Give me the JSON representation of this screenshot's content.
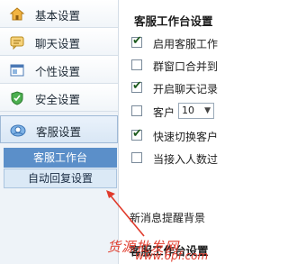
{
  "sidebar": {
    "items": [
      {
        "label": "基本设置",
        "icon": "house-icon"
      },
      {
        "label": "聊天设置",
        "icon": "chat-icon"
      },
      {
        "label": "个性设置",
        "icon": "window-icon"
      },
      {
        "label": "安全设置",
        "icon": "shield-icon"
      },
      {
        "label": "客服设置",
        "icon": "service-icon"
      }
    ],
    "sub_items": [
      {
        "label": "客服工作台",
        "state": "active"
      },
      {
        "label": "自动回复设置",
        "state": "normal"
      }
    ]
  },
  "main": {
    "section_title": "客服工作台设置",
    "options": [
      {
        "label": "启用客服工作",
        "checked": true
      },
      {
        "label": "群窗口合并到",
        "checked": false
      },
      {
        "label": "开启聊天记录",
        "checked": true
      },
      {
        "label": "客户",
        "checked": false,
        "select_value": "10"
      },
      {
        "label": "快速切换客户",
        "checked": true
      },
      {
        "label": "当接入人数过",
        "checked": false
      }
    ],
    "note": "新消息提醒背景",
    "sub_title": "客服工作台设置"
  },
  "watermark": {
    "text": "货源批发网",
    "url": "www.6pf.com"
  },
  "colors": {
    "sidebar_bg": "#eef3f8",
    "sub_active_bg": "#5b8fc9",
    "sub_normal_bg": "#dbe9f6",
    "annotation": "#e03b2c"
  }
}
